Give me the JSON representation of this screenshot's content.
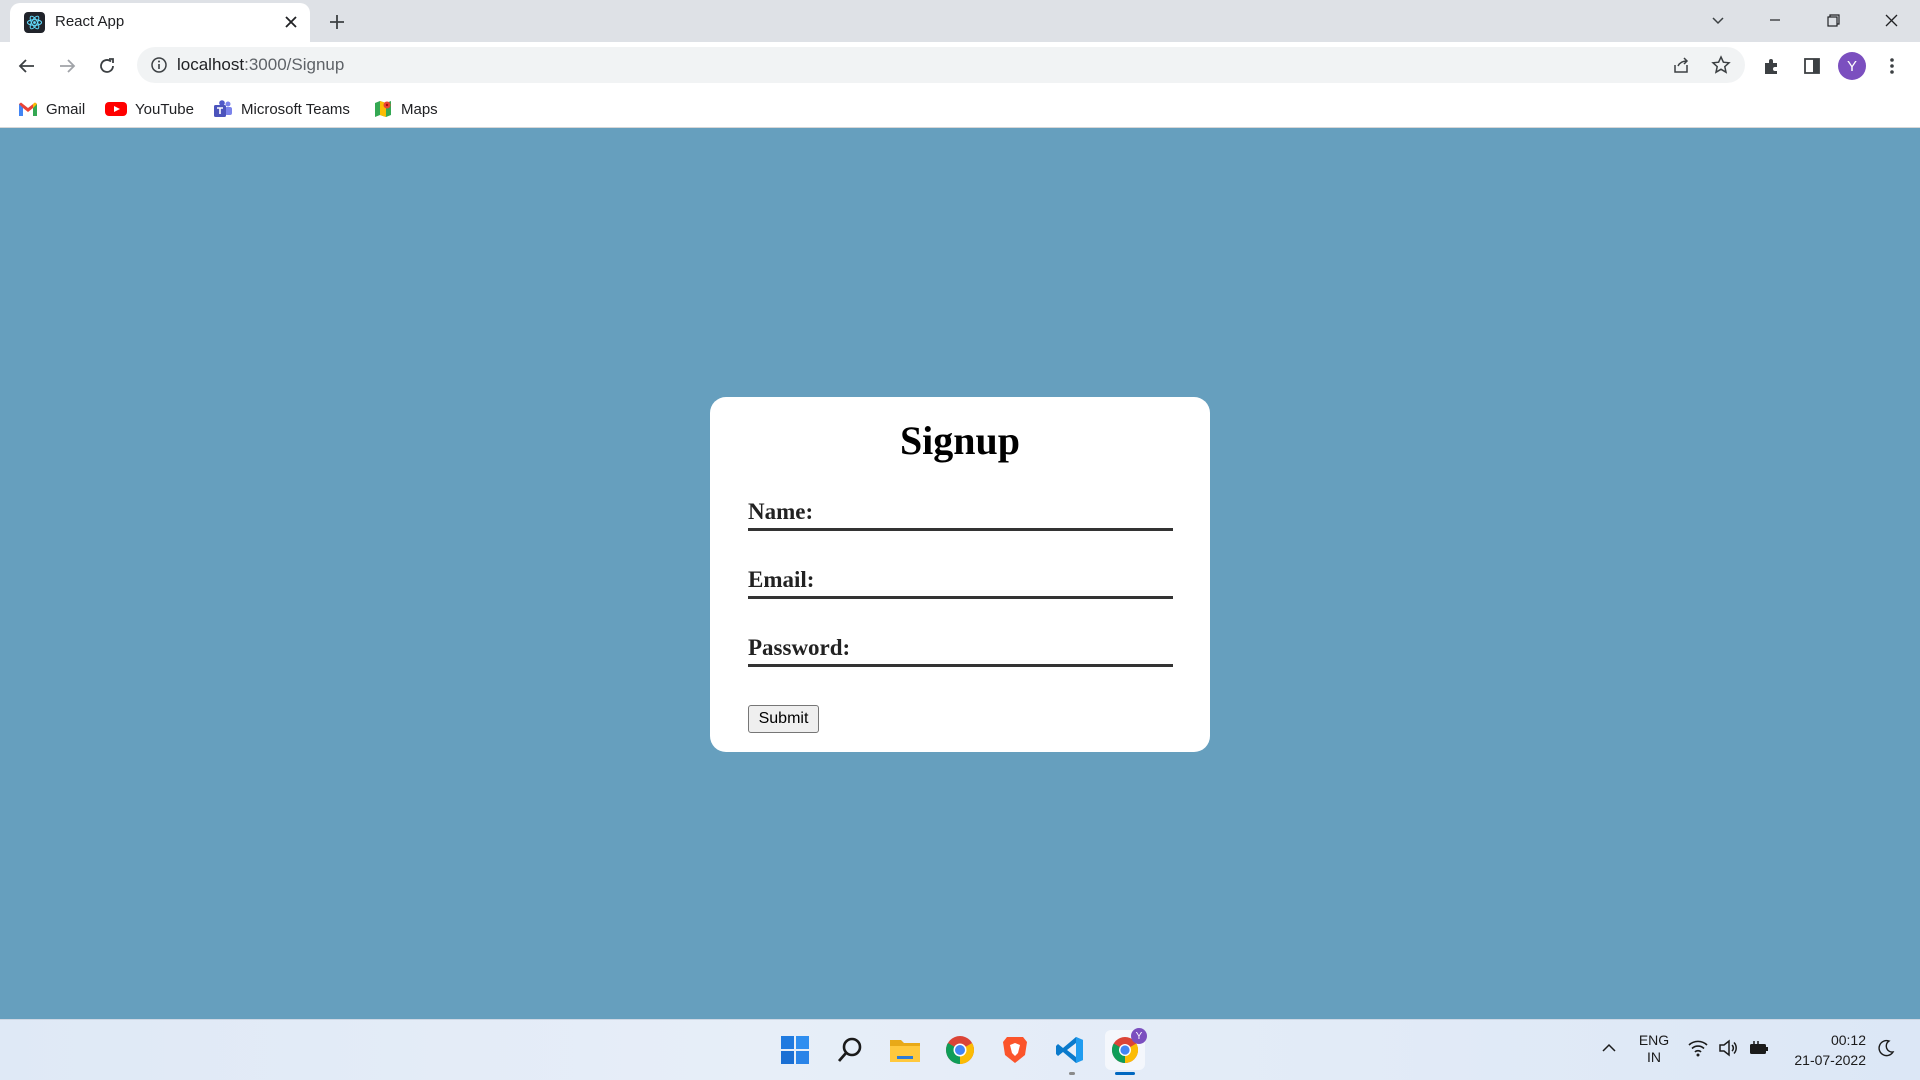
{
  "browser": {
    "tab_title": "React App",
    "url_host": "localhost",
    "url_path": ":3000/Signup",
    "profile_initial": "Y",
    "bookmarks": [
      {
        "label": "Gmail",
        "icon": "gmail-icon"
      },
      {
        "label": "YouTube",
        "icon": "youtube-icon"
      },
      {
        "label": "Microsoft Teams",
        "icon": "teams-icon"
      },
      {
        "label": "Maps",
        "icon": "maps-icon"
      }
    ]
  },
  "form": {
    "title": "Signup",
    "fields": [
      {
        "label": "Name:",
        "value": ""
      },
      {
        "label": "Email:",
        "value": ""
      },
      {
        "label": "Password:",
        "value": ""
      }
    ],
    "submit_label": "Submit"
  },
  "taskbar": {
    "language_line1": "ENG",
    "language_line2": "IN",
    "time": "00:12",
    "date": "21-07-2022",
    "chrome_badge": "Y"
  },
  "colors": {
    "page_background": "#669fbe",
    "card_background": "#ffffff",
    "profile_avatar": "#7b4fbf"
  }
}
